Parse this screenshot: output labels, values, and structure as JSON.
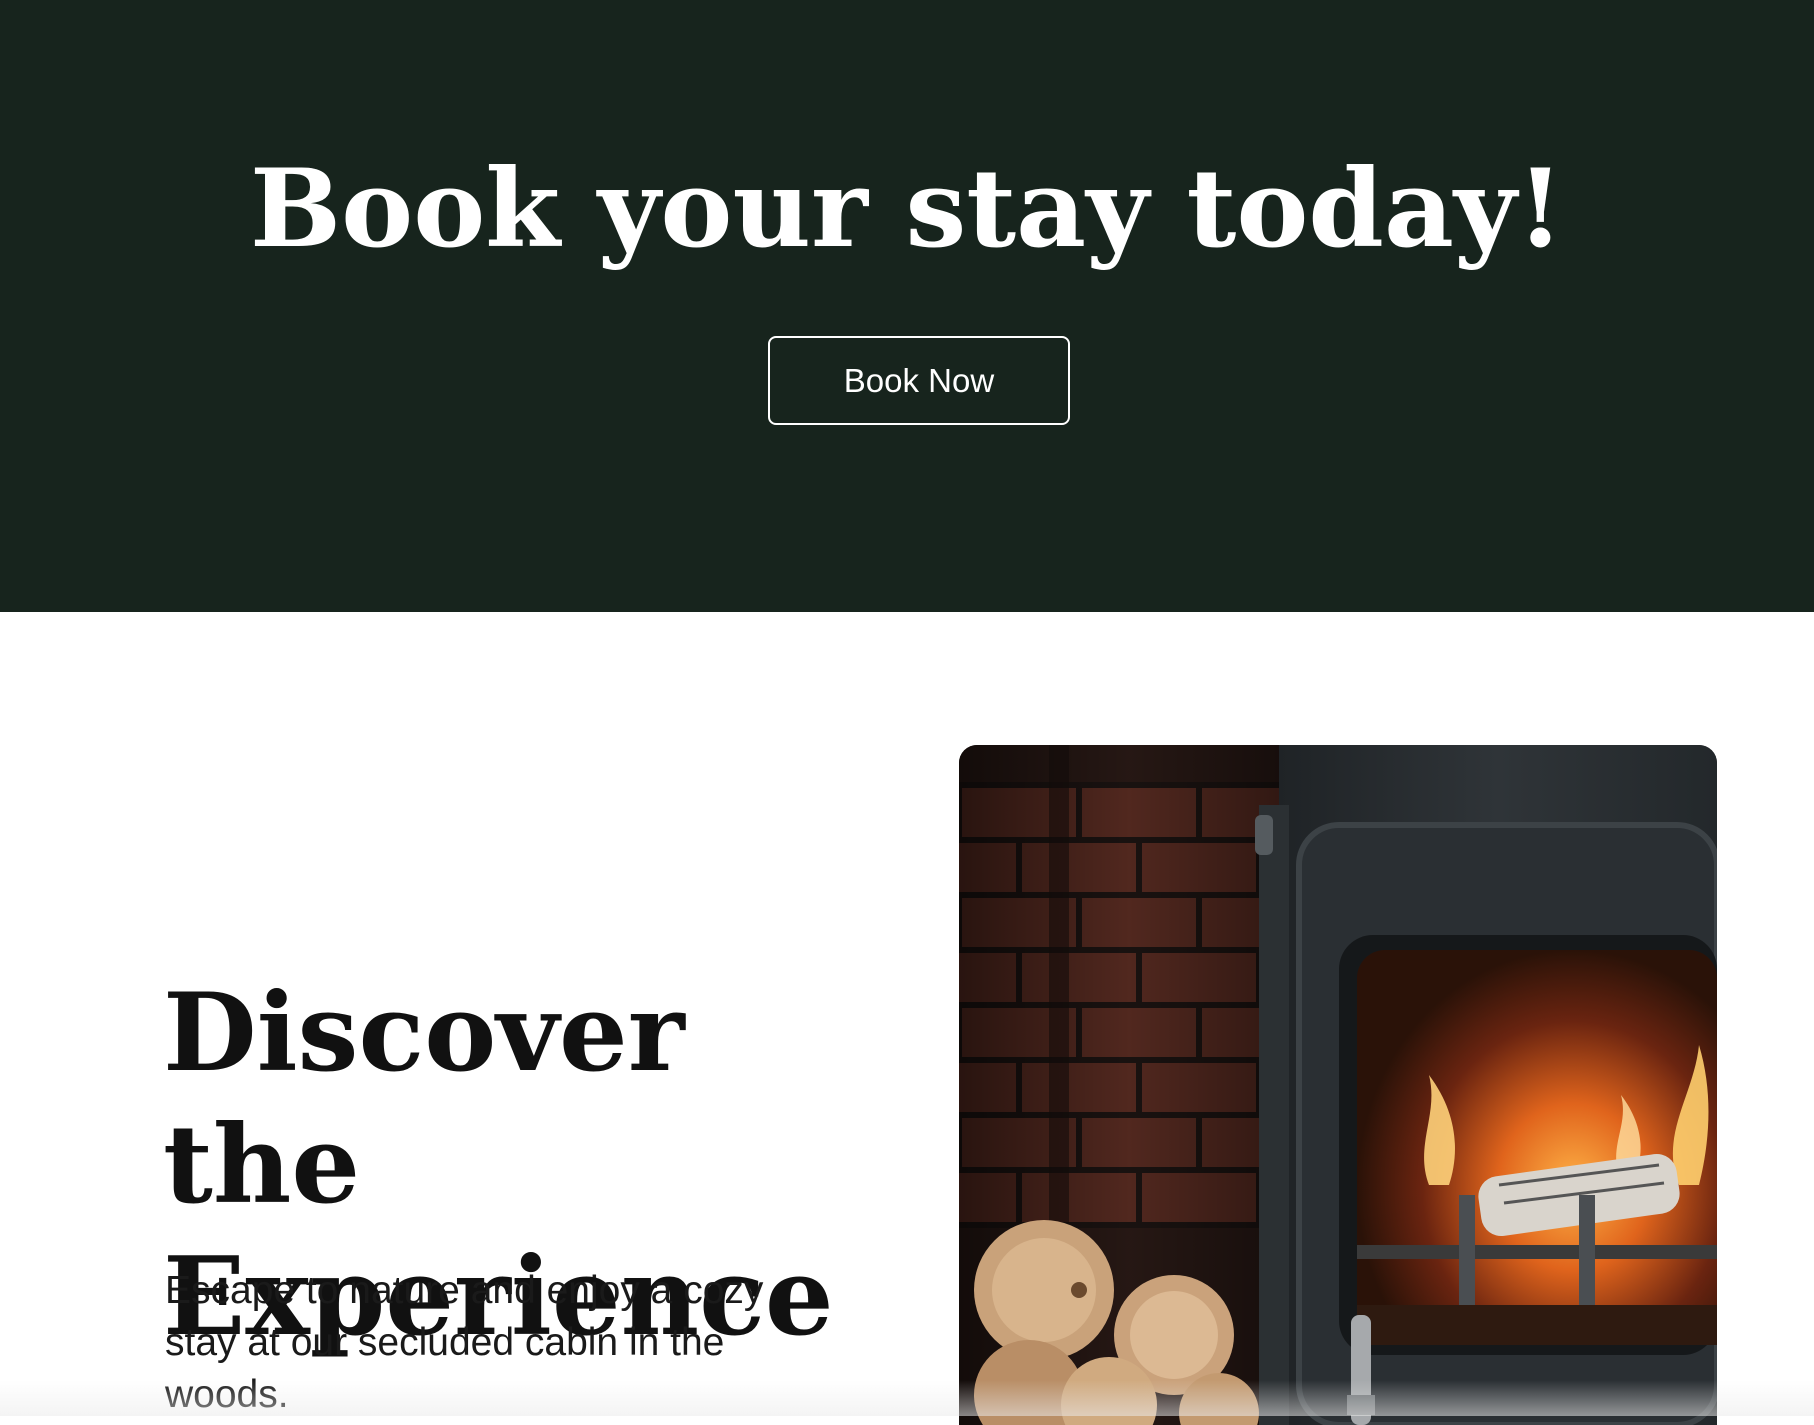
{
  "hero": {
    "title": "Book your stay today!",
    "button_label": "Book Now",
    "background_color": "#17241d"
  },
  "experience": {
    "title": "Discover the Experience",
    "description": "Escape to nature and enjoy a cozy stay at our secluded cabin in the woods.",
    "image_subject": "wood-burning-stove-with-fire-and-firewood-stack"
  }
}
